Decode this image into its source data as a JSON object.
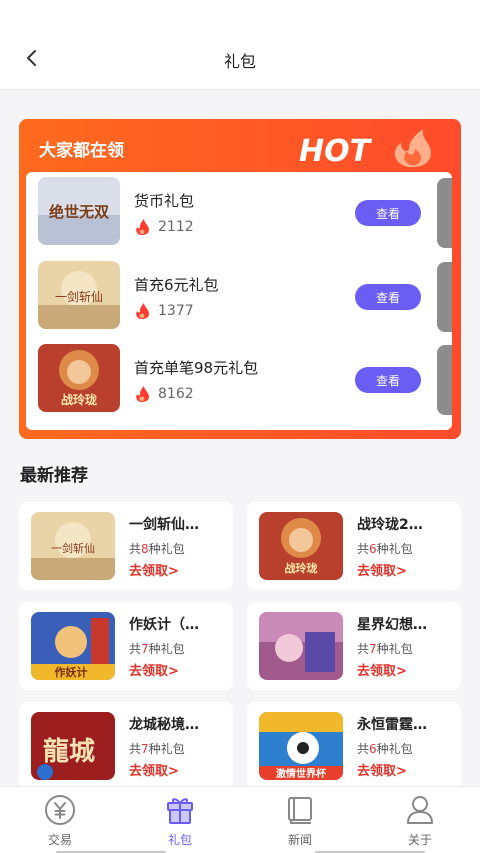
{
  "header": {
    "title": "礼包"
  },
  "hot": {
    "title": "大家都在领",
    "logo_text": "HOT",
    "items": [
      {
        "name": "货币礼包",
        "count": "2112",
        "button": "查看",
        "thumb_color": "#d9dee8",
        "thumb_text": "绝世无双"
      },
      {
        "name": "首充6元礼包",
        "count": "1377",
        "button": "查看",
        "thumb_color": "#e9d4a8",
        "thumb_text": "一剑斩仙"
      },
      {
        "name": "首充单笔98元礼包",
        "count": "8162",
        "button": "查看",
        "thumb_color": "#b8402c",
        "thumb_text": "战玲珑"
      }
    ]
  },
  "recommend": {
    "title": "最新推荐",
    "items": [
      {
        "name": "一剑斩仙…",
        "prefix": "共",
        "num": "8",
        "suffix": "种礼包",
        "action": "去领取>",
        "thumb_color": "#e9d4a8",
        "thumb_text": "一剑斩仙"
      },
      {
        "name": "战玲珑2…",
        "prefix": "共",
        "num": "6",
        "suffix": "种礼包",
        "action": "去领取>",
        "thumb_color": "#b8402c",
        "thumb_text": "战玲珑"
      },
      {
        "name": "作妖计（…",
        "prefix": "共",
        "num": "7",
        "suffix": "种礼包",
        "action": "去领取>",
        "thumb_color": "#3a5fb8",
        "thumb_text": "作妖计"
      },
      {
        "name": "星界幻想…",
        "prefix": "共",
        "num": "7",
        "suffix": "种礼包",
        "action": "去领取>",
        "thumb_color": "#a05a8c",
        "thumb_text": ""
      },
      {
        "name": "龙城秘境…",
        "prefix": "共",
        "num": "7",
        "suffix": "种礼包",
        "action": "去领取>",
        "thumb_color": "#9c1e1e",
        "thumb_text": "龍城"
      },
      {
        "name": "永恒雷霆…",
        "prefix": "共",
        "num": "6",
        "suffix": "种礼包",
        "action": "去领取>",
        "thumb_color": "#2f7fd1",
        "thumb_text": "激情世界杯"
      }
    ]
  },
  "nav": [
    {
      "label": "交易",
      "icon": "yen-coin-icon"
    },
    {
      "label": "礼包",
      "icon": "gift-icon"
    },
    {
      "label": "新闻",
      "icon": "book-icon"
    },
    {
      "label": "关于",
      "icon": "user-icon"
    }
  ],
  "colors": {
    "accent": "#6a5df3",
    "hot_orange": "#ff5a24",
    "action_red": "#e0322a",
    "flame": "#ff3d2e"
  }
}
